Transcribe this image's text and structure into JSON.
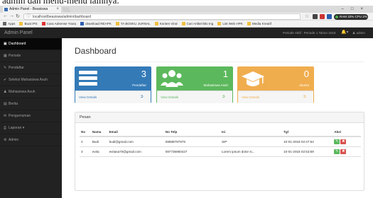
{
  "caption": "admin dan menu-menu lainnya.",
  "browser": {
    "tab_title": "Admin Panel - Beasiswa",
    "url": "localhost/beasiswa/admin/dashboard",
    "sysmon": "RAM 33%  CPU 2%",
    "bookmarks": [
      "Apps",
      "Buat IPS",
      "Cara Adsense Youtu",
      "download REAPK",
      "TA BOSKU JURNAL",
      "Konten Viral",
      "Cari Artikel Blo Ing",
      "List Web HPK",
      "Media Kreatif"
    ]
  },
  "topnav": {
    "brand": "Admin Panel",
    "periode": "Periode Aktif : Periode 1 Tahun 2018",
    "user": "admin"
  },
  "sidebar": {
    "items": [
      {
        "icon": "▣",
        "label": "Dashboard"
      },
      {
        "icon": "▦",
        "label": "Periode"
      },
      {
        "icon": "✎",
        "label": "Pendaftar"
      },
      {
        "icon": "✔",
        "label": "Seleksi Mahasiswa Asuh"
      },
      {
        "icon": "♟",
        "label": "Mahasiswa Asuh"
      },
      {
        "icon": "▤",
        "label": "Berita"
      },
      {
        "icon": "✉",
        "label": "Pengumuman"
      },
      {
        "icon": "⎙",
        "label": "Laporan ▾"
      },
      {
        "icon": "⚙",
        "label": "Admin"
      }
    ]
  },
  "main": {
    "title": "Dashboard",
    "cards": [
      {
        "count": "3",
        "label": "Pendaftar",
        "link": "View Details",
        "color": "#337ab7"
      },
      {
        "count": "1",
        "label": "Mahasiswa Asuh",
        "link": "View Details",
        "color": "#5cb85c"
      },
      {
        "count": "0",
        "label": "Alumni",
        "link": "View Details",
        "color": "#f0ad4e"
      }
    ],
    "panel_title": "Pesan",
    "table": {
      "headers": [
        "No",
        "Nama",
        "Email",
        "No Telp",
        "Isi",
        "Tgl",
        "Aksi"
      ],
      "rows": [
        [
          "2",
          "Budi",
          "budi@gmail.com",
          "08888797878",
          "SIP",
          "10-01-2018 02:47:54"
        ],
        [
          "3",
          "evita",
          "evitasa70@gmail.com",
          "087736960427",
          "Lorem ipsum dolor si...",
          "10-01-2018 02:53:59"
        ]
      ]
    }
  }
}
